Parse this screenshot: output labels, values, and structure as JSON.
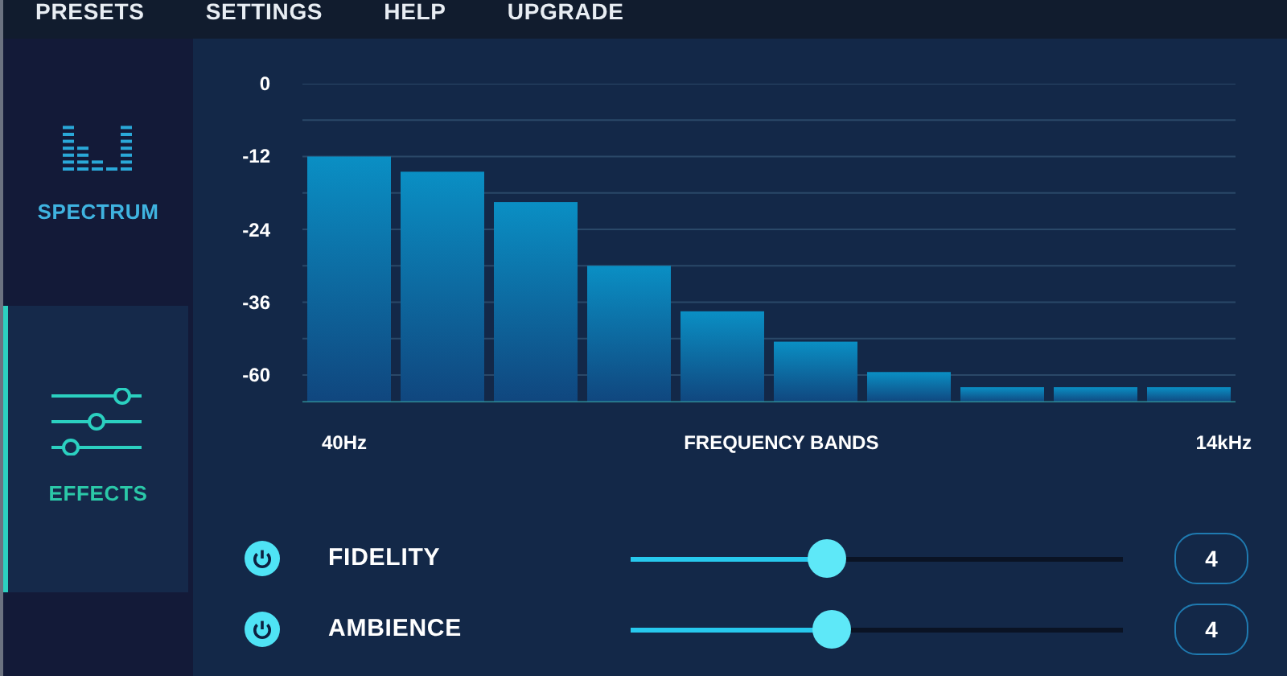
{
  "menu": [
    {
      "label": "PRESETS"
    },
    {
      "label": "SETTINGS"
    },
    {
      "label": "HELP"
    },
    {
      "label": "UPGRADE"
    }
  ],
  "sidebar": {
    "items": [
      {
        "label": "SPECTRUM",
        "kind": "spectrum",
        "selected": false
      },
      {
        "label": "EFFECTS",
        "kind": "effects",
        "selected": true
      }
    ]
  },
  "spectrum": {
    "y_labels": [
      "0",
      "-12",
      "-24",
      "-36",
      "-60"
    ],
    "x_start": "40Hz",
    "x_title": "FREQUENCY BANDS",
    "x_end": "14kHz"
  },
  "effects": [
    {
      "name": "FIDELITY",
      "on": true,
      "level": 0.4,
      "value": "4"
    },
    {
      "name": "AMBIENCE",
      "on": true,
      "level": 0.41,
      "value": "4"
    }
  ]
}
